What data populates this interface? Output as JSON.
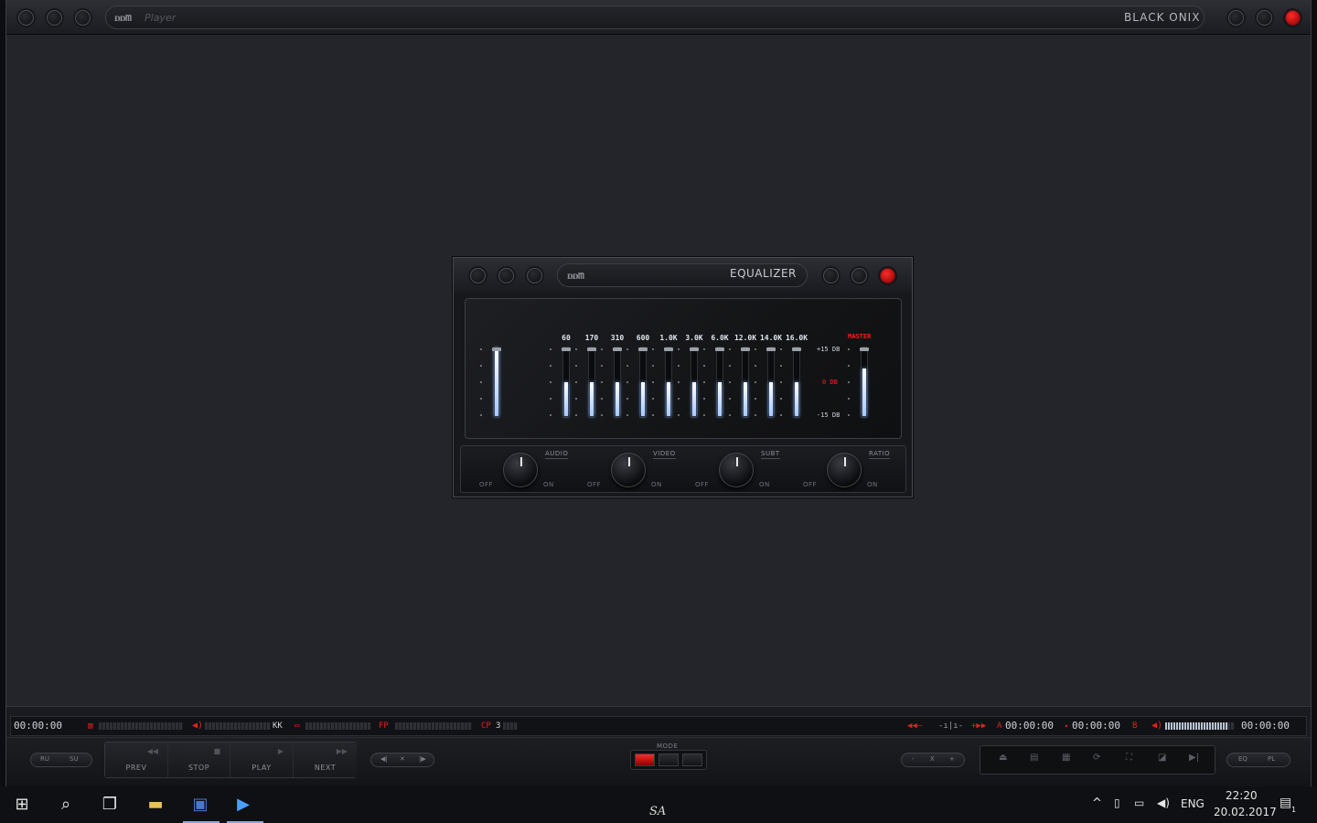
{
  "window": {
    "logo": "ᴅᴅm",
    "logo_sub": "Player",
    "skin_name": "BLACK  ONIX"
  },
  "equalizer": {
    "logo": "ᴅᴅm",
    "title": "EQUALIZER",
    "bands": [
      {
        "label": "60",
        "level": 0.5
      },
      {
        "label": "170",
        "level": 0.5
      },
      {
        "label": "310",
        "level": 0.5
      },
      {
        "label": "600",
        "level": 0.5
      },
      {
        "label": "1.0K",
        "level": 0.5
      },
      {
        "label": "3.0K",
        "level": 0.5
      },
      {
        "label": "6.0K",
        "level": 0.5
      },
      {
        "label": "12.0K",
        "level": 0.5
      },
      {
        "label": "14.0K",
        "level": 0.5
      },
      {
        "label": "16.0K",
        "level": 0.5
      }
    ],
    "preamp_level": 1.0,
    "db_top": "+15 DB",
    "db_mid": "0 DB",
    "db_bottom": "-15 DB",
    "master_label": "MASTER",
    "master_level": 0.7,
    "knobs": [
      {
        "title": "AUDIO",
        "off": "OFF",
        "on": "ON"
      },
      {
        "title": "VIDEO",
        "off": "OFF",
        "on": "ON"
      },
      {
        "title": "SUBT",
        "off": "OFF",
        "on": "ON"
      },
      {
        "title": "RATIO",
        "off": "OFF",
        "on": "ON"
      }
    ]
  },
  "status": {
    "time_left": "00:00:00",
    "speaker_extra": "KK",
    "fp": "FP",
    "cp": "CP",
    "cp_value": "3",
    "ab_a": "A",
    "ab_a_time": "00:00:00",
    "ab_b_time": "00:00:00",
    "ab_b": "B",
    "time_right": "00:00:00",
    "colors": {
      "accent": "#e0241e",
      "text": "#d0d3d8"
    }
  },
  "controls": {
    "lang_left": "RU",
    "lang_right": "SU",
    "prev": "PREV",
    "stop": "STOP",
    "play": "PLAY",
    "next": "NEXT",
    "mode_label": "MODE",
    "zoom_minus": "-",
    "zoom_x": "X",
    "zoom_plus": "+",
    "eq_btn": "EQ",
    "pl_btn": "PL"
  },
  "taskbar": {
    "center_text": "SA",
    "lang": "ENG",
    "time": "22:20",
    "date": "20.02.2017",
    "notification_count": "1"
  }
}
